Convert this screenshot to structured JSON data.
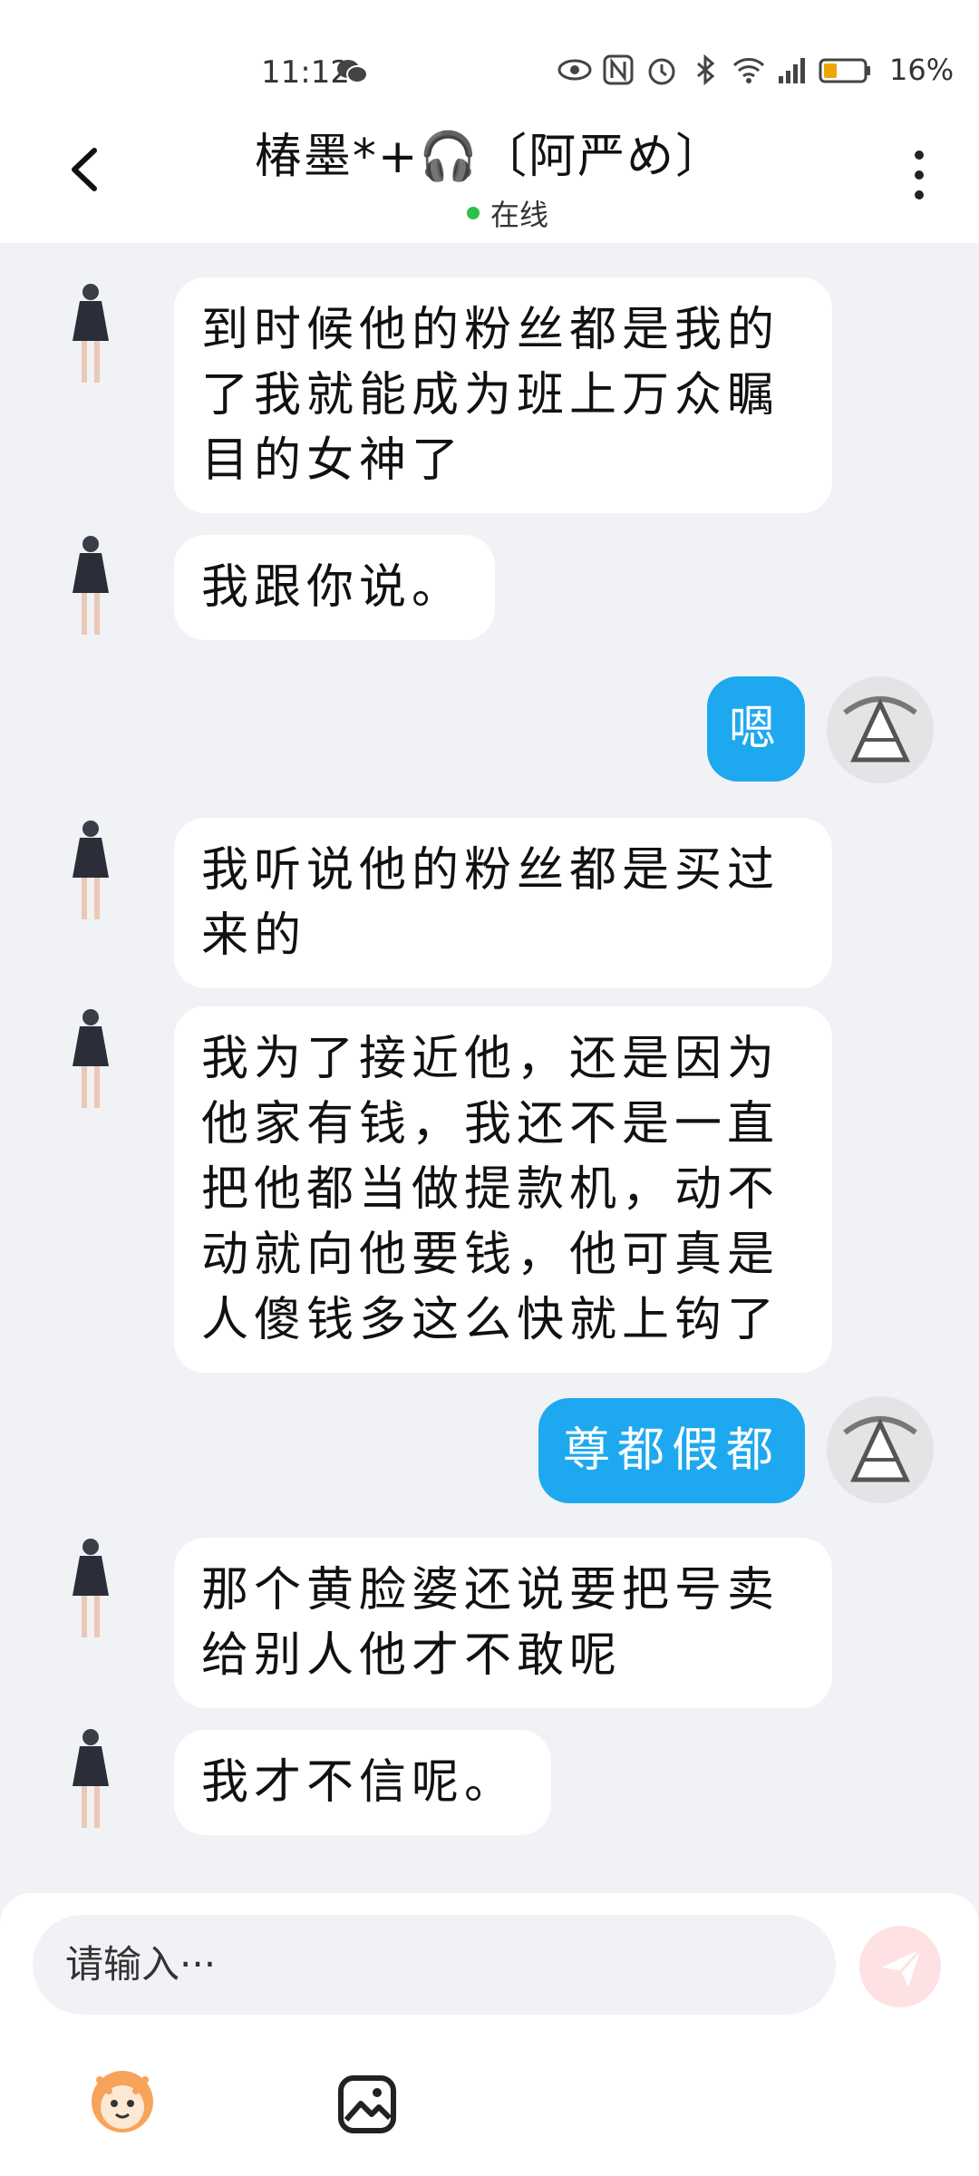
{
  "status_bar": {
    "time": "11:12",
    "battery": "16%"
  },
  "header": {
    "title": "椿墨*+🎧〔阿严め〕",
    "status": "在线"
  },
  "messages": [
    {
      "side": "left",
      "text": "到时候他的粉丝都是我的了我就能成为班上万众瞩目的女神了"
    },
    {
      "side": "left",
      "text": "我跟你说。"
    },
    {
      "side": "right",
      "text": "嗯"
    },
    {
      "side": "left",
      "text": "我听说他的粉丝都是买过来的"
    },
    {
      "side": "left",
      "text": "我为了接近他，还是因为他家有钱，我还不是一直把他都当做提款机，动不动就向他要钱，他可真是人傻钱多这么快就上钩了"
    },
    {
      "side": "right",
      "text": "尊都假都"
    },
    {
      "side": "left",
      "text": "那个黄脸婆还说要把号卖给别人他才不敢呢"
    },
    {
      "side": "left",
      "text": "我才不信呢。"
    }
  ],
  "composer": {
    "placeholder": "请输入···"
  },
  "colors": {
    "me_bubble": "#1ea8ef",
    "online_dot": "#2dbf4a",
    "send_button": "#fde1e3"
  },
  "icons": [
    "back-icon",
    "more-icon",
    "send-icon",
    "emoji-icon",
    "image-icon",
    "wechat-icon",
    "eye-icon",
    "nfc-icon",
    "alarm-icon",
    "bluetooth-icon",
    "wifi-icon",
    "signal-icon",
    "battery-icon"
  ]
}
